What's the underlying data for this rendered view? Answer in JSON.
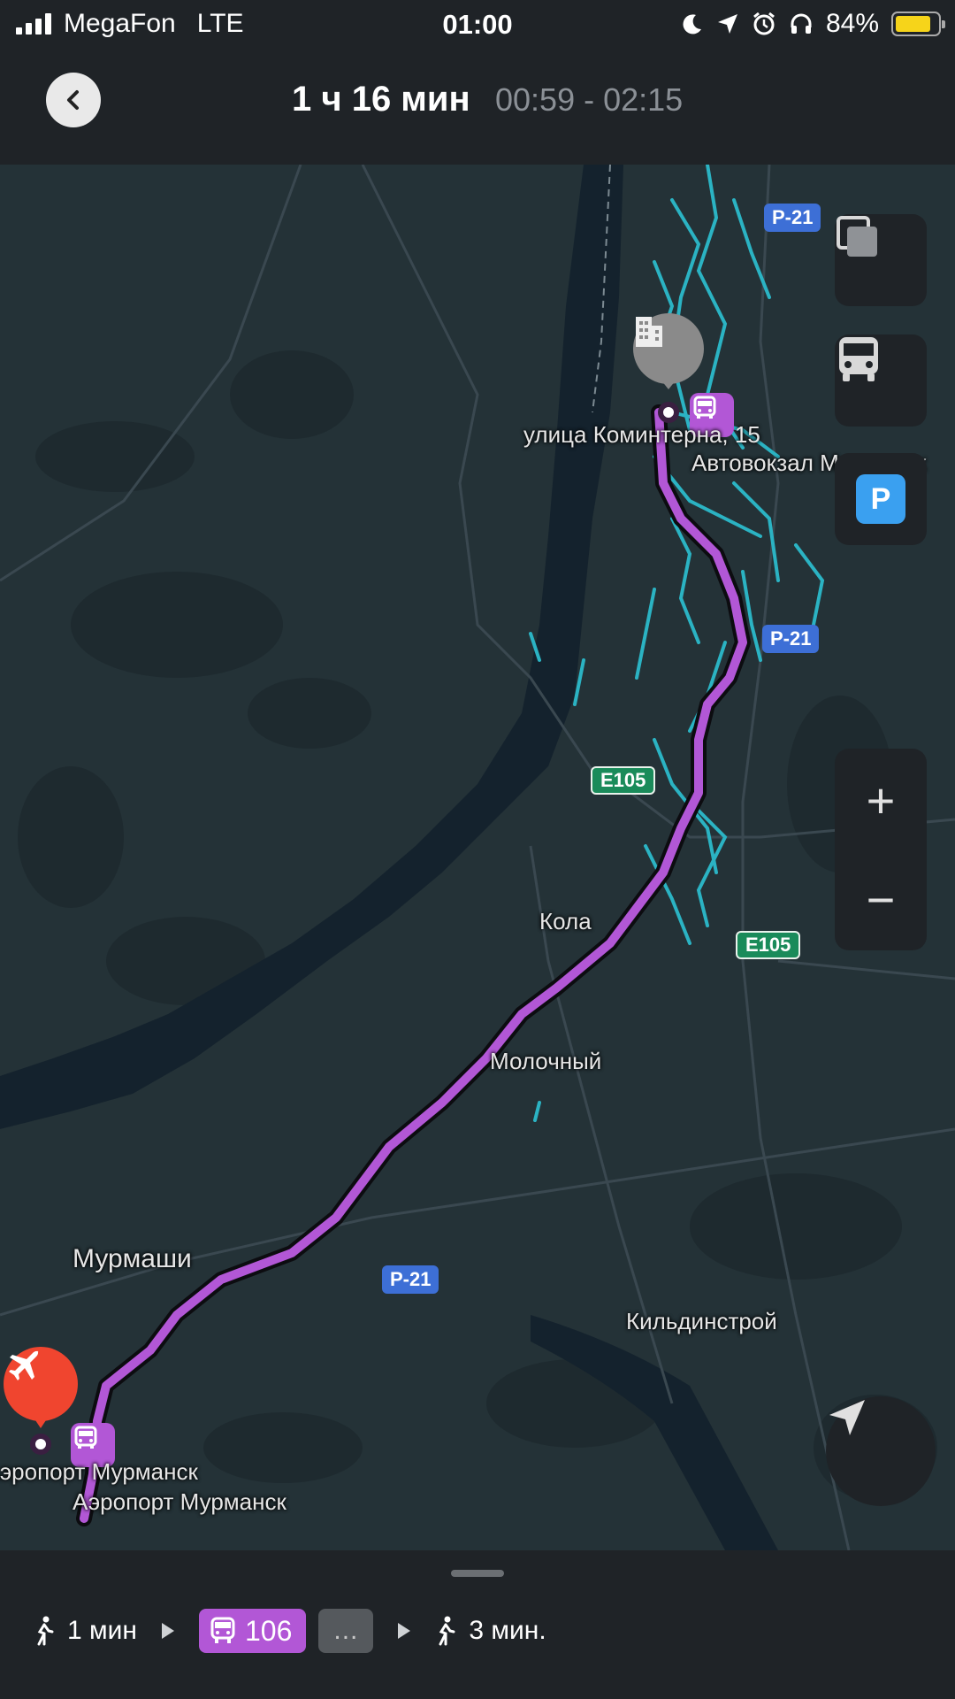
{
  "status_bar": {
    "carrier": "MegaFon",
    "network": "LTE",
    "time": "01:00",
    "battery": "84%",
    "battery_level": 0.84
  },
  "header": {
    "duration": "1 ч 16 мин",
    "time_range": "00:59 - 02:15"
  },
  "map": {
    "labels": {
      "origin_address": "улица Коминтерна, 15",
      "origin_stop": "Автовокзал Мурманск",
      "kola": "Кола",
      "molochny": "Молочный",
      "murmashi": "Мурмаши",
      "kildinstroy": "Кильдинстрой",
      "airport_place": "Аэропорт Мурманск",
      "airport_stop": "Аэропорт Мурманск"
    },
    "shields": {
      "r21_top": "Р-21",
      "r21_mid": "Р-21",
      "r21_bottom": "Р-21",
      "e105_top": "E105",
      "e105_bottom": "E105"
    },
    "route_color": "#b257d6",
    "controls": {
      "zoom_in": "+",
      "zoom_out": "−",
      "parking": "P"
    }
  },
  "route_steps": {
    "walk_start": "1 мин",
    "bus_number": "106",
    "more": "...",
    "walk_end": "3 мин."
  }
}
